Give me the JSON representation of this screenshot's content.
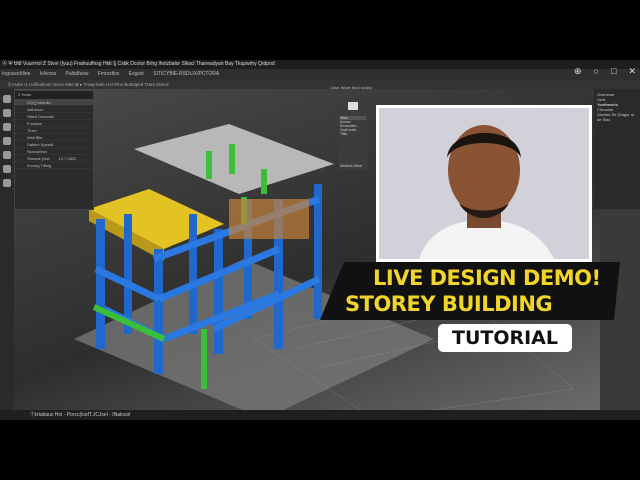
{
  "menubar": {
    "text": "Ⓐ Ψ Ʉdl  Vuurrriol  Ƶ Stvvr  (lyuu)  Fnahuulfnsg Hkit  Ȿ Csbk  Dcotor Brhg Iholzbalor Sliiacl Thaneadyan Bay Tkupwrhy Qrdpod"
  },
  "ribbon": {
    "items": [
      "Ingoaxe/tline",
      "Ivlivoss",
      "Paltalfsow",
      "Fmrsstlox",
      "Exgsst",
      "SITICYBIE-RSDLIX/PCTORA"
    ]
  },
  "window_controls": [
    "⊕",
    "○",
    "□",
    "✕"
  ],
  "toolbar": {
    "text": "Ŝ Hube  I1  Holfsalmon  Sorrs  Mbe   ⊞  ▸ Tmap bele Hot Pins Bo8alped Trare Dimoc"
  },
  "left_panel": {
    "title": "Ʃ Hotor",
    "search": "DQ/Ʒ ebuulio",
    "rows": [
      "ludbeoon",
      "Sitied Deacrdio",
      "Fuuwwe",
      "Tluch",
      "Wall Blin",
      "Daldev-Speadi",
      "Sluvoplean",
      "Sheade (Not",
      "Knvmg Tdiolg"
    ],
    "value": "12.7.0822"
  },
  "info_panel": {
    "label": "Hlatu",
    "items": [
      "Anowo",
      "Ermsoldes",
      "Hoaf oreta",
      "Tiitio"
    ],
    "footer": "Nefulsis Sleve"
  },
  "viewport": {
    "caption": "Chiar Wlver bis Inocdioi"
  },
  "right_panel": {
    "title": "Ocemnoe",
    "items": [
      "Uovt",
      "Yoctlmvelu",
      "Chruuion"
    ],
    "text": "Oisvtsd Sir (Dagor ui de Slav"
  },
  "statusbar": {
    "left": "Ⓣlxlubaus Hoi",
    "mid": "Porcc(iosfT.JCJxel",
    "right": "INalosol"
  },
  "headline": {
    "line1": "LIVE DESIGN DEMO!",
    "line2": "STOREY BUILDING",
    "badge": "TUTORIAL"
  },
  "colors": {
    "headline": "#f1d52a",
    "steel": "#1f6fd0",
    "beam": "#e8c62a",
    "pipe": "#3bbf3a"
  }
}
